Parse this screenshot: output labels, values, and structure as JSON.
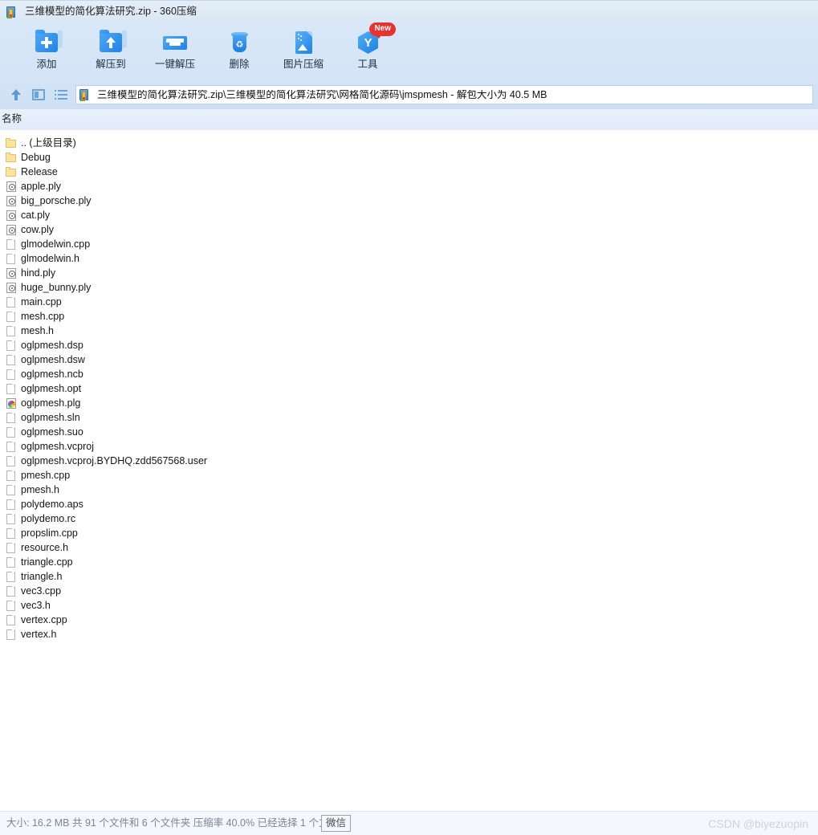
{
  "window": {
    "title": "三维模型的简化算法研究.zip - 360压缩",
    "icon": "zip-archive-icon"
  },
  "toolbar": {
    "buttons": [
      {
        "label": "添加",
        "icon": "folder-add-icon"
      },
      {
        "label": "解压到",
        "icon": "folder-extract-icon"
      },
      {
        "label": "一键解压",
        "icon": "one-click-extract-icon"
      },
      {
        "label": "删除",
        "icon": "trash-icon"
      },
      {
        "label": "图片压缩",
        "icon": "image-compress-icon"
      },
      {
        "label": "工具",
        "icon": "tools-hexagon-icon",
        "badge": "New"
      }
    ]
  },
  "address_bar": {
    "up_icon": "up-arrow-icon",
    "panel_icon": "panel-view-icon",
    "list_icon": "list-view-icon",
    "path": "三维模型的简化算法研究.zip\\三维模型的简化算法研究\\网格简化源码\\jmspmesh - 解包大小为 40.5 MB"
  },
  "list": {
    "columns": [
      "名称"
    ],
    "rows": [
      {
        "name": ".. (上级目录)",
        "icon": "folder-icon",
        "type": "folder"
      },
      {
        "name": "Debug",
        "icon": "folder-icon",
        "type": "folder"
      },
      {
        "name": "Release",
        "icon": "folder-icon",
        "type": "folder"
      },
      {
        "name": "apple.ply",
        "icon": "ply-file-icon",
        "type": "ply"
      },
      {
        "name": "big_porsche.ply",
        "icon": "ply-file-icon",
        "type": "ply"
      },
      {
        "name": "cat.ply",
        "icon": "ply-file-icon",
        "type": "ply"
      },
      {
        "name": "cow.ply",
        "icon": "ply-file-icon",
        "type": "ply"
      },
      {
        "name": "glmodelwin.cpp",
        "icon": "document-icon",
        "type": "file"
      },
      {
        "name": "glmodelwin.h",
        "icon": "document-icon",
        "type": "file"
      },
      {
        "name": "hind.ply",
        "icon": "ply-file-icon",
        "type": "ply"
      },
      {
        "name": "huge_bunny.ply",
        "icon": "ply-file-icon",
        "type": "ply"
      },
      {
        "name": "main.cpp",
        "icon": "document-icon",
        "type": "file"
      },
      {
        "name": "mesh.cpp",
        "icon": "document-icon",
        "type": "file"
      },
      {
        "name": "mesh.h",
        "icon": "document-icon",
        "type": "file"
      },
      {
        "name": "oglpmesh.dsp",
        "icon": "document-icon",
        "type": "file"
      },
      {
        "name": "oglpmesh.dsw",
        "icon": "document-icon",
        "type": "file"
      },
      {
        "name": "oglpmesh.ncb",
        "icon": "document-icon",
        "type": "file"
      },
      {
        "name": "oglpmesh.opt",
        "icon": "document-icon",
        "type": "file"
      },
      {
        "name": "oglpmesh.plg",
        "icon": "browser-file-icon",
        "type": "plg"
      },
      {
        "name": "oglpmesh.sln",
        "icon": "document-icon",
        "type": "file"
      },
      {
        "name": "oglpmesh.suo",
        "icon": "document-icon",
        "type": "file"
      },
      {
        "name": "oglpmesh.vcproj",
        "icon": "document-icon",
        "type": "file"
      },
      {
        "name": "oglpmesh.vcproj.BYDHQ.zdd567568.user",
        "icon": "document-icon",
        "type": "file"
      },
      {
        "name": "pmesh.cpp",
        "icon": "document-icon",
        "type": "file"
      },
      {
        "name": "pmesh.h",
        "icon": "document-icon",
        "type": "file"
      },
      {
        "name": "polydemo.aps",
        "icon": "document-icon",
        "type": "file"
      },
      {
        "name": "polydemo.rc",
        "icon": "document-icon",
        "type": "file"
      },
      {
        "name": "propslim.cpp",
        "icon": "document-icon",
        "type": "file"
      },
      {
        "name": "resource.h",
        "icon": "document-icon",
        "type": "file"
      },
      {
        "name": "triangle.cpp",
        "icon": "document-icon",
        "type": "file"
      },
      {
        "name": "triangle.h",
        "icon": "document-icon",
        "type": "file"
      },
      {
        "name": "vec3.cpp",
        "icon": "document-icon",
        "type": "file"
      },
      {
        "name": "vec3.h",
        "icon": "document-icon",
        "type": "file"
      },
      {
        "name": "vertex.cpp",
        "icon": "document-icon",
        "type": "file"
      },
      {
        "name": "vertex.h",
        "icon": "document-icon",
        "type": "file"
      }
    ]
  },
  "status_bar": {
    "text": "大小: 16.2 MB 共 91 个文件和 6 个文件夹 压缩率 40.0% 已经选择 1 个文",
    "wechat_button": "微信",
    "watermark": "CSDN @biyezuopin"
  },
  "colors": {
    "accent": "#1f82e8",
    "titlebar": "#dfeaf6",
    "toolbar": "#d6e6f7",
    "badge_red": "#e8322d",
    "folder_yellow": "#fbe3a0"
  }
}
